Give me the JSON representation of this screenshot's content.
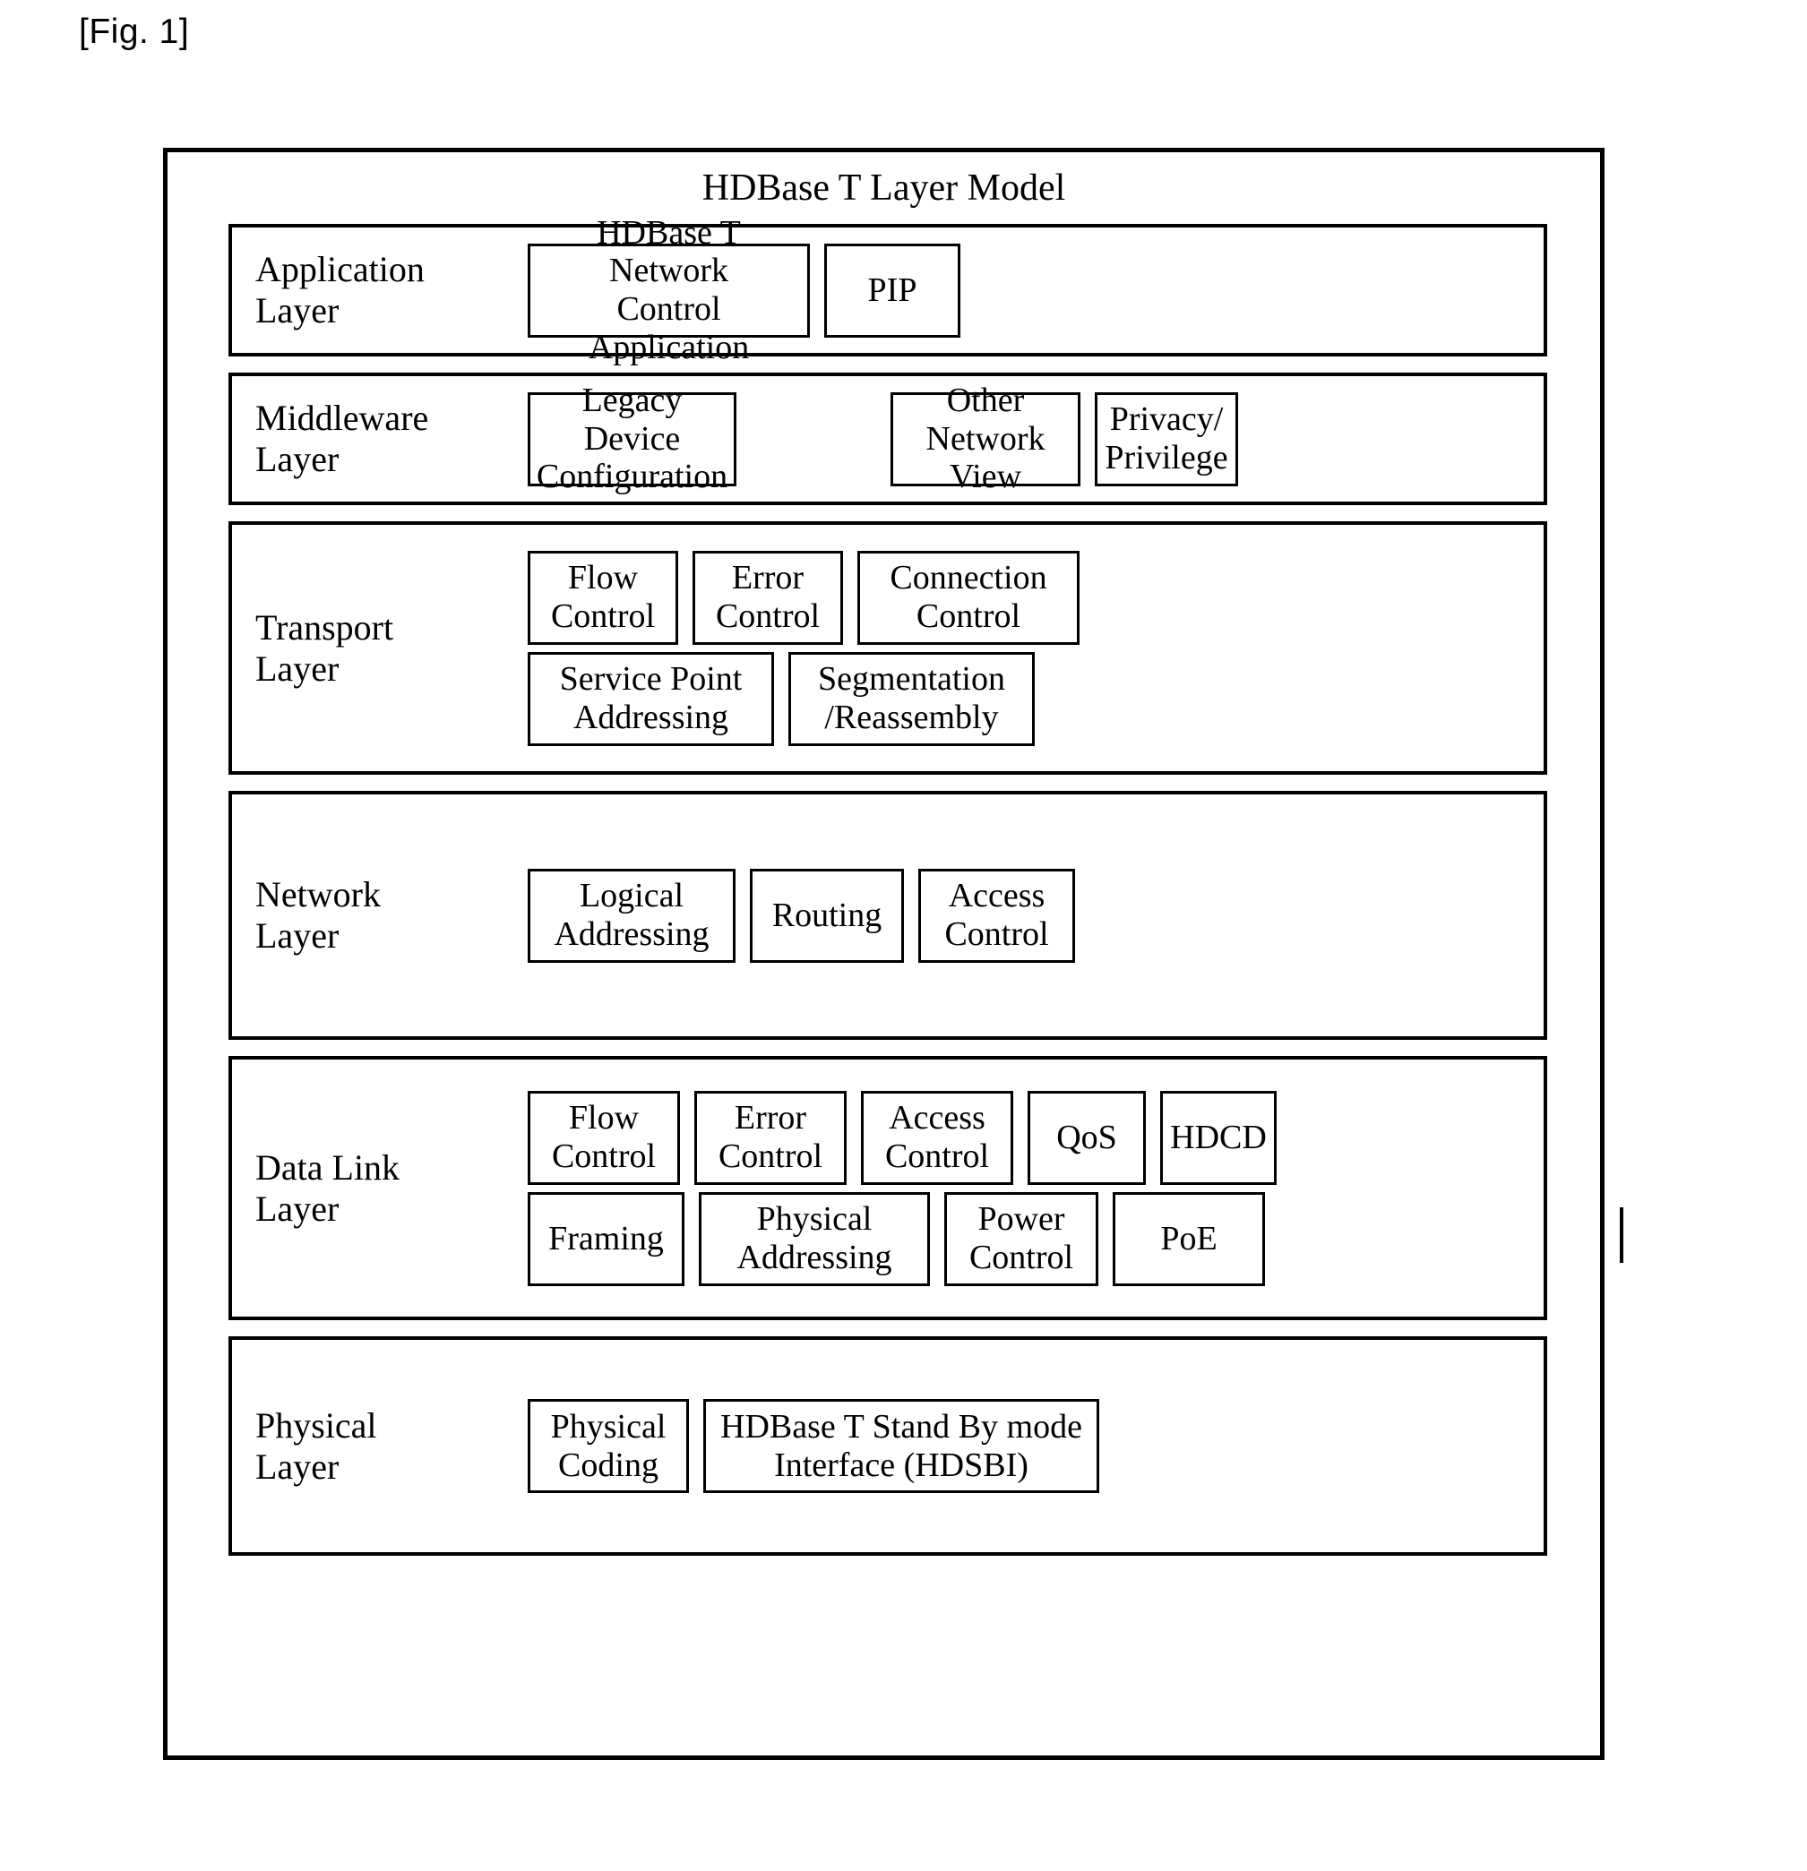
{
  "figure_label": "[Fig. 1]",
  "diagram": {
    "title": "HDBase T Layer Model",
    "layers": [
      {
        "name": "Application\nLayer",
        "rows": [
          [
            {
              "label": "HDBase T Network\nControl Application"
            },
            {
              "label": "PIP"
            }
          ]
        ]
      },
      {
        "name": "Middleware\nLayer",
        "rows": [
          [
            {
              "label": "Legacy Device\nConfiguration"
            },
            {
              "label": ""
            },
            {
              "label": "Other\nNetwork View"
            },
            {
              "label": "Privacy/\nPrivilege"
            }
          ]
        ]
      },
      {
        "name": "Transport\nLayer",
        "rows": [
          [
            {
              "label": "Flow\nControl"
            },
            {
              "label": "Error\nControl"
            },
            {
              "label": "Connection\nControl"
            }
          ],
          [
            {
              "label": "Service Point\nAddressing"
            },
            {
              "label": "Segmentation\n/Reassembly"
            }
          ]
        ]
      },
      {
        "name": "Network\nLayer",
        "rows": [
          [
            {
              "label": "Logical\nAddressing"
            },
            {
              "label": "Routing"
            },
            {
              "label": "Access\nControl"
            }
          ]
        ]
      },
      {
        "name": "Data Link\nLayer",
        "rows": [
          [
            {
              "label": "Flow\nControl"
            },
            {
              "label": "Error\nControl"
            },
            {
              "label": "Access\nControl"
            },
            {
              "label": "QoS"
            },
            {
              "label": "HDCD"
            }
          ],
          [
            {
              "label": "Framing"
            },
            {
              "label": "Physical\nAddressing"
            },
            {
              "label": "Power\nControl"
            },
            {
              "label": "PoE"
            }
          ]
        ]
      },
      {
        "name": "Physical\nLayer",
        "rows": [
          [
            {
              "label": "Physical\nCoding"
            },
            {
              "label": "HDBase T Stand By mode\nInterface (HDSBI)"
            }
          ]
        ]
      }
    ]
  },
  "colors": {
    "line": "#000000",
    "background": "#ffffff",
    "text": "#000000"
  }
}
